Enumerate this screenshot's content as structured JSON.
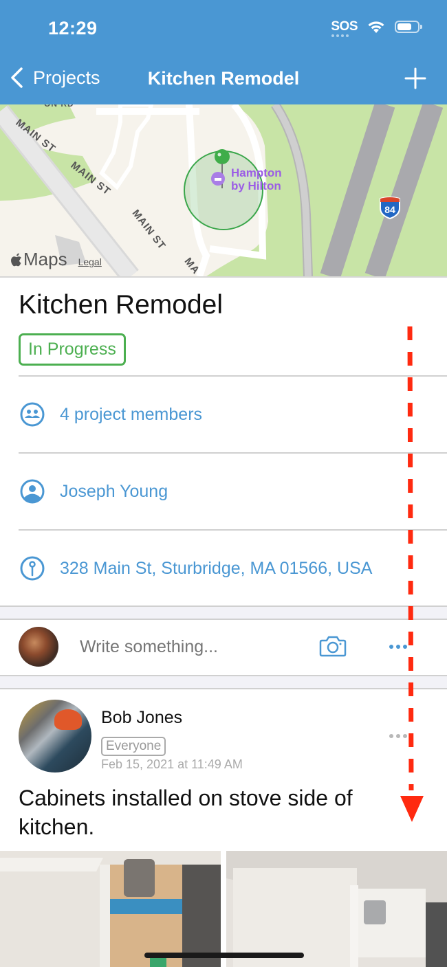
{
  "status_bar": {
    "time": "12:29",
    "carrier": "SOS"
  },
  "nav": {
    "back_label": "Projects",
    "title": "Kitchen Remodel",
    "add_icon": "plus-icon"
  },
  "map": {
    "credit": "Maps",
    "legal": "Legal",
    "poi_label_line1": "Hampton",
    "poi_label_line2": "by Hilton",
    "streets": [
      "MAIN ST",
      "MAIN ST",
      "MAIN ST",
      "MAIN ST",
      "MA"
    ],
    "road_top": "ON RD",
    "highway_shield": "84"
  },
  "project": {
    "title": "Kitchen Remodel",
    "status": "In Progress",
    "status_color": "#4caf50"
  },
  "info_rows": [
    {
      "icon": "members-icon",
      "label": "4 project members"
    },
    {
      "icon": "person-icon",
      "label": "Joseph Young"
    },
    {
      "icon": "location-pin-icon",
      "label": "328 Main St, Sturbridge, MA 01566, USA"
    }
  ],
  "composer": {
    "placeholder": "Write something..."
  },
  "post": {
    "author": "Bob Jones",
    "audience": "Everyone",
    "date": "Feb 15, 2021 at 11:49 AM",
    "body": "Cabinets installed on stove side of kitchen."
  },
  "colors": {
    "accent": "#4a97d3",
    "annotation": "#ff2a10"
  }
}
